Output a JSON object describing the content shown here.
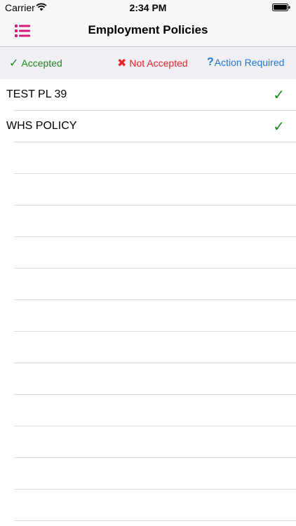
{
  "status_bar": {
    "carrier": "Carrier",
    "time": "2:34 PM"
  },
  "nav": {
    "title": "Employment Policies",
    "menu_icon": "list-icon",
    "accent_color": "#d6197a"
  },
  "legend": {
    "accepted": {
      "glyph": "✓",
      "label": "Accepted",
      "color": "#1f8a1f"
    },
    "not_accepted": {
      "glyph": "✖",
      "label": "Not Accepted",
      "color": "#e8242a"
    },
    "action_required": {
      "glyph": "?",
      "label": "Action Required",
      "color": "#1e78d6"
    }
  },
  "policies": [
    {
      "name": "TEST PL 39",
      "status_glyph": "✓",
      "status": "accepted"
    },
    {
      "name": "WHS POLICY",
      "status_glyph": "✓",
      "status": "accepted"
    }
  ],
  "empty_rows": 12
}
